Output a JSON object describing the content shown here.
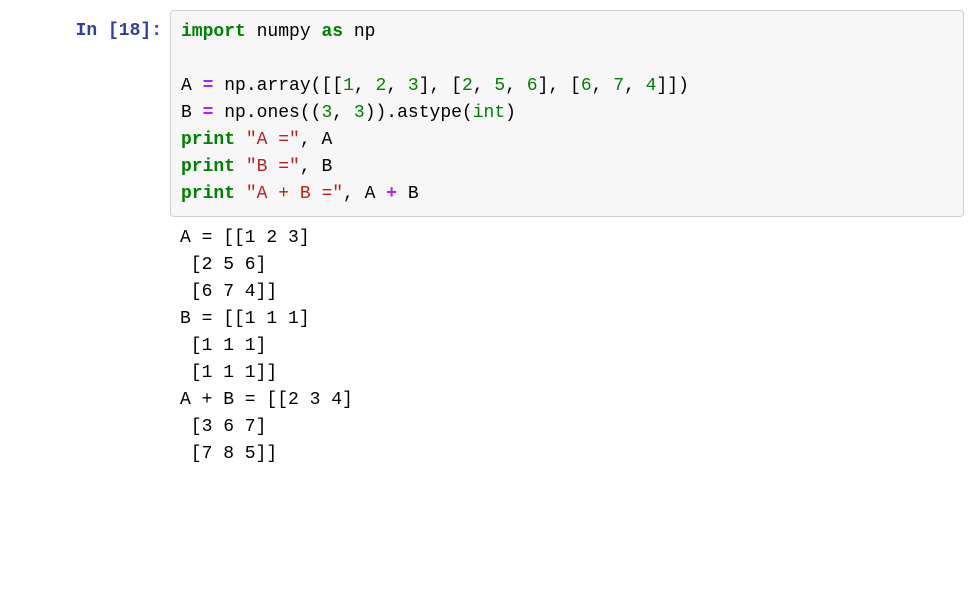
{
  "prompt": {
    "prefix": "In [",
    "number": "18",
    "suffix": "]:"
  },
  "code": {
    "line1": {
      "kw_import": "import",
      "sp1": " ",
      "mod": "numpy",
      "sp2": " ",
      "kw_as": "as",
      "sp3": " ",
      "alias": "np"
    },
    "blank": "",
    "line3": {
      "var_a": "A",
      "sp1": " ",
      "eq": "=",
      "sp2": " ",
      "np_array": "np.array([[",
      "n1": "1",
      "c1": ", ",
      "n2": "2",
      "c2": ", ",
      "n3": "3",
      "mid1": "], [",
      "n4": "2",
      "c3": ", ",
      "n5": "5",
      "c4": ", ",
      "n6": "6",
      "mid2": "], [",
      "n7": "6",
      "c5": ", ",
      "n8": "7",
      "c6": ", ",
      "n9": "4",
      "end": "]])"
    },
    "line4": {
      "var_b": "B",
      "sp1": " ",
      "eq": "=",
      "sp2": " ",
      "np_ones": "np.ones((",
      "n1": "3",
      "c1": ", ",
      "n2": "3",
      "mid": ")).astype(",
      "int_t": "int",
      "end": ")"
    },
    "line5": {
      "kw_print": "print",
      "sp1": " ",
      "str": "\"A =\"",
      "c1": ", ",
      "var": "A"
    },
    "line6": {
      "kw_print": "print",
      "sp1": " ",
      "str": "\"B =\"",
      "c1": ", ",
      "var": "B"
    },
    "line7": {
      "kw_print": "print",
      "sp1": " ",
      "str": "\"A + B =\"",
      "c1": ", ",
      "var_a": "A",
      "sp2": " ",
      "plus": "+",
      "sp3": " ",
      "var_b": "B"
    }
  },
  "output": "A = [[1 2 3]\n [2 5 6]\n [6 7 4]]\nB = [[1 1 1]\n [1 1 1]\n [1 1 1]]\nA + B = [[2 3 4]\n [3 6 7]\n [7 8 5]]"
}
